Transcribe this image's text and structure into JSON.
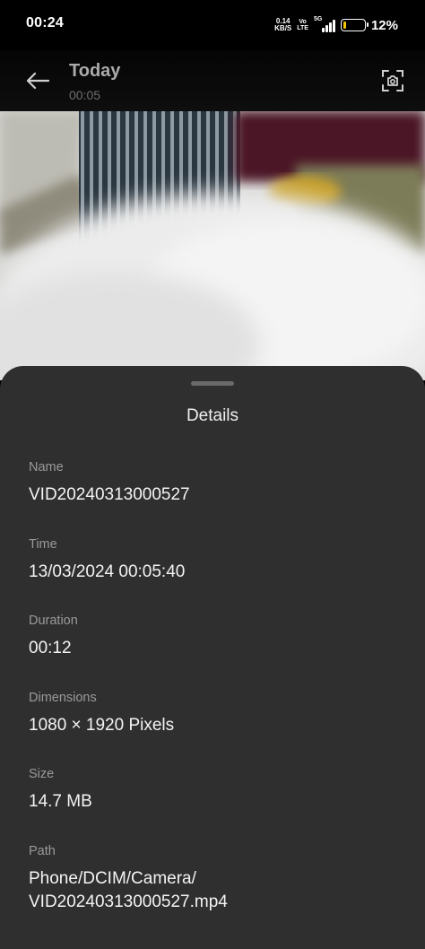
{
  "status_bar": {
    "time": "00:24",
    "net_speed_value": "0.14",
    "net_speed_unit": "KB/S",
    "volte_top": "Vo",
    "volte_bottom": "LTE",
    "network_type": "5G",
    "battery_percent": "12%",
    "battery_level": 0.12,
    "battery_color": "#f5c400"
  },
  "app_bar": {
    "back_icon": "arrow-left-icon",
    "title": "Today",
    "subtitle": "00:05",
    "capture_icon": "screenshot-capture-icon"
  },
  "details_sheet": {
    "title": "Details",
    "items": [
      {
        "label": "Name",
        "value": "VID20240313000527"
      },
      {
        "label": "Time",
        "value": "13/03/2024 00:05:40"
      },
      {
        "label": "Duration",
        "value": "00:12"
      },
      {
        "label": "Dimensions",
        "value": "1080 × 1920 Pixels"
      },
      {
        "label": "Size",
        "value": "14.7 MB"
      },
      {
        "label": "Path",
        "value_line1": "Phone/DCIM/Camera/",
        "value_line2": "VID20240313000527.mp4"
      }
    ]
  },
  "colors": {
    "sheet_background": "#2f2f2f",
    "label_color": "#9a9a9a",
    "value_color": "#f4f4f4"
  }
}
